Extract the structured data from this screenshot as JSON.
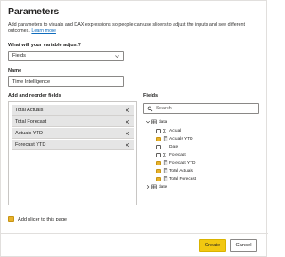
{
  "dialog": {
    "title": "Parameters",
    "description": "Add parameters to visuals and DAX expressions so people can use slicers to adjust the inputs and see different outcomes.",
    "learn_more": "Learn more"
  },
  "variable": {
    "label": "What will your variable adjust?",
    "value": "Fields"
  },
  "name": {
    "label": "Name",
    "value": "Time Intelligence"
  },
  "add_fields": {
    "label": "Add and reorder fields",
    "items": [
      "Total Actuals",
      "Total Forecast",
      "Actuals YTD",
      "Forecast YTD"
    ]
  },
  "fields_pane": {
    "label": "Fields",
    "search_placeholder": "Search",
    "tree": [
      {
        "label": "data",
        "kind": "table",
        "expanded": true,
        "checked": false
      },
      {
        "label": "Actual",
        "kind": "sigma",
        "checked": false
      },
      {
        "label": "Actuals YTD",
        "kind": "measure",
        "checked": true
      },
      {
        "label": "Date",
        "kind": "none",
        "checked": false
      },
      {
        "label": "Forecast",
        "kind": "sigma",
        "checked": false
      },
      {
        "label": "Forecast YTD",
        "kind": "measure",
        "checked": true
      },
      {
        "label": "Total Actuals",
        "kind": "measure",
        "checked": true
      },
      {
        "label": "Total Forecast",
        "kind": "measure",
        "checked": true
      },
      {
        "label": "date",
        "kind": "table",
        "expanded": false,
        "checked": false
      }
    ]
  },
  "slicer": {
    "label": "Add slicer to this page",
    "checked": true
  },
  "buttons": {
    "create": "Create",
    "cancel": "Cancel"
  },
  "colors": {
    "accent": "#f2c811",
    "checkbox_on": "#e8b22b",
    "link": "#0f6cbd"
  }
}
